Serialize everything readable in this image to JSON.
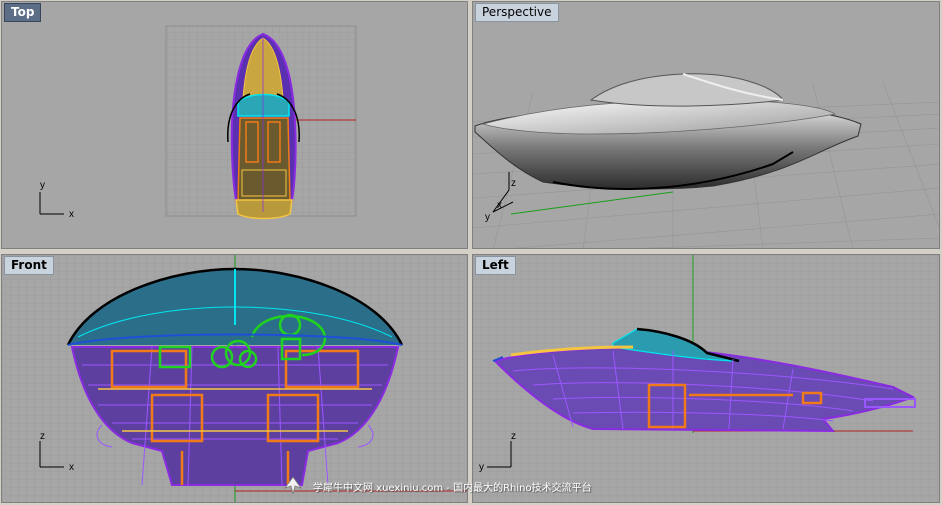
{
  "viewports": {
    "top": {
      "label": "Top",
      "axis_x": "x",
      "axis_y": "y"
    },
    "perspective": {
      "label": "Perspective",
      "axis_x": "x",
      "axis_y": "y",
      "axis_z": "z"
    },
    "front": {
      "label": "Front",
      "axis_x": "x",
      "axis_z": "z"
    },
    "left": {
      "label": "Left",
      "axis_y": "y",
      "axis_z": "z"
    }
  },
  "watermark": {
    "text": "学犀牛中文网 xuexiniu.com - 国内最大的Rhino技术交流平台"
  },
  "colors": {
    "viewport_bg": "#a6a6a6",
    "grid": "#959595",
    "wire_purple": "#8a2be2",
    "wire_cyan": "#00e5ee",
    "wire_orange": "#f07a18",
    "wire_yellow": "#f5c542",
    "wire_green": "#1fd31f",
    "axis_red": "#b02020",
    "axis_green": "#1a9e1a"
  }
}
